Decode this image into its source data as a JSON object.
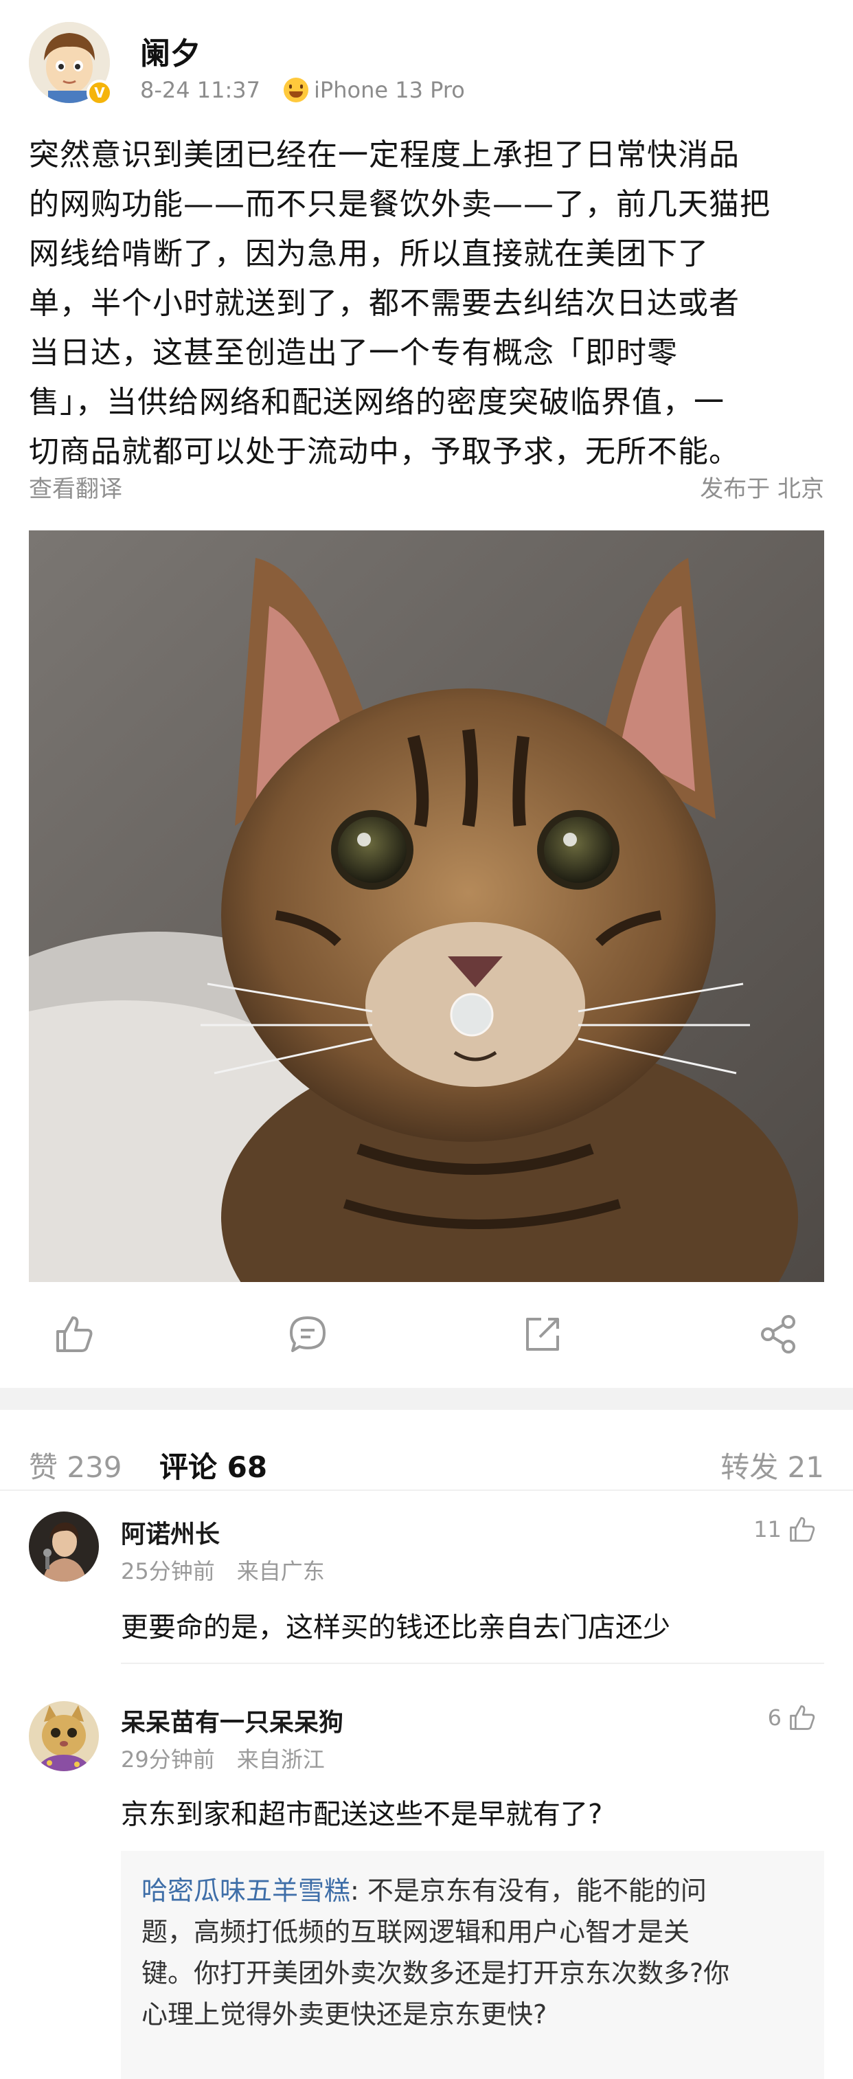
{
  "post": {
    "username": "阑夕",
    "timestamp": "8-24 11:37",
    "device": "iPhone 13 Pro",
    "lines": [
      "突然意识到美团已经在一定程度上承担了日常快消品",
      "的网购功能——而不只是餐饮外卖——了，前几天猫把",
      "网线给啃断了，因为急用，所以直接就在美团下了",
      "单，半个小时就送到了，都不需要去纠结次日达或者",
      "当日达，这甚至创造出了一个专有概念「即时零",
      "售」，当供给网络和配送网络的密度突破临界值，一",
      "切商品就都可以处于流动中，予取予求，无所不能。"
    ],
    "translate_label": "查看翻译",
    "published_label": "发布于 北京"
  },
  "actions": {
    "icons": [
      "like-icon",
      "comment-icon",
      "repost-icon",
      "share-icon"
    ]
  },
  "tabs": {
    "likes": "赞 239",
    "comments": "评论 68",
    "reposts": "转发 21"
  },
  "comments": [
    {
      "name": "阿诺州长",
      "time": "25分钟前",
      "location": "来自广东",
      "likes": "11",
      "text": "更要命的是，这样买的钱还比亲自去门店还少"
    },
    {
      "name": "呆呆苗有一只呆呆狗",
      "time": "29分钟前",
      "location": "来自浙江",
      "likes": "6",
      "text": "京东到家和超市配送这些不是早就有了?",
      "reply": {
        "author": "哈密瓜味五羊雪糕",
        "lines": [
          ": 不是京东有没有，能不能的问",
          "题，高频打低频的互联网逻辑和用户心智才是关",
          "键。你打开美团外卖次数多还是打开京东次数多?你",
          "心理上觉得外卖更快还是京东更快?"
        ]
      }
    }
  ],
  "colors": {
    "link_blue": "#3e6ea8",
    "verify_gold": "#f5b40b",
    "muted_gray": "#9a9a9a"
  }
}
